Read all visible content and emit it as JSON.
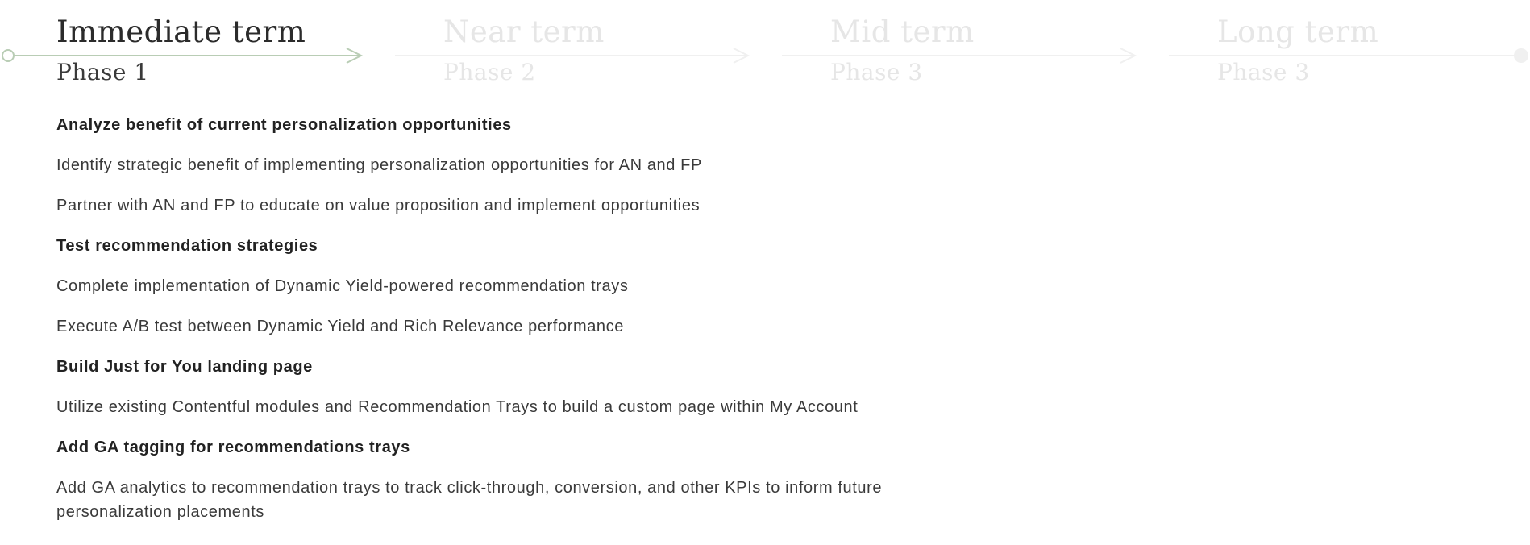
{
  "colors": {
    "active_line": "#b9cdb5",
    "inactive_line": "#f0f0f0",
    "active_text": "#2b2b2b",
    "inactive_text": "#e6e6e6"
  },
  "timeline": {
    "phases": [
      {
        "title": "Immediate term",
        "subtitle": "Phase 1",
        "active": true
      },
      {
        "title": "Near term",
        "subtitle": "Phase 2",
        "active": false
      },
      {
        "title": "Mid term",
        "subtitle": "Phase 3",
        "active": false
      },
      {
        "title": "Long term",
        "subtitle": "Phase 3",
        "active": false
      }
    ]
  },
  "content": {
    "items": [
      {
        "text": "Analyze benefit of current personalization opportunities",
        "heading": true
      },
      {
        "text": "Identify strategic benefit of implementing personalization opportunities for AN and FP",
        "heading": false
      },
      {
        "text": "Partner with AN and FP to educate on value proposition and implement opportunities",
        "heading": false
      },
      {
        "text": "Test recommendation strategies",
        "heading": true
      },
      {
        "text": "Complete implementation of Dynamic Yield-powered recommendation trays",
        "heading": false
      },
      {
        "text": "Execute A/B test between Dynamic Yield and Rich Relevance performance",
        "heading": false
      },
      {
        "text": "Build Just for You landing page",
        "heading": true
      },
      {
        "text": "Utilize existing Contentful modules and Recommendation Trays to build a custom page within My Account",
        "heading": false
      },
      {
        "text": "Add GA tagging for recommendations trays",
        "heading": true
      },
      {
        "text": "Add GA analytics to recommendation trays to track click-through, conversion, and other KPIs  to inform future personalization placements",
        "heading": false
      }
    ]
  }
}
